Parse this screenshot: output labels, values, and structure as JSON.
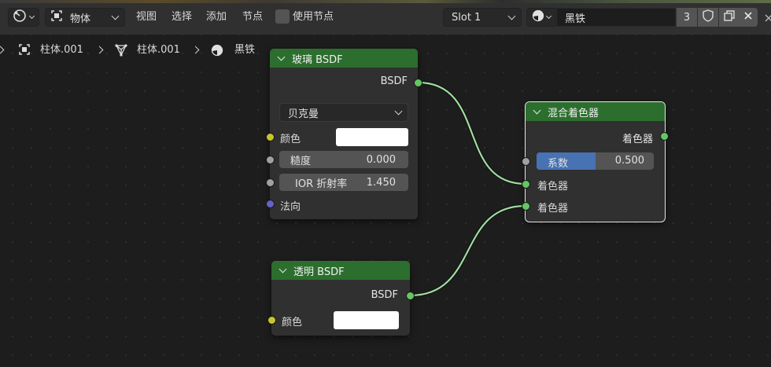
{
  "header": {
    "mode_select_icon": "editor-type-icon",
    "object_mode_label": "物体",
    "menus": [
      "视图",
      "选择",
      "添加",
      "节点"
    ],
    "use_nodes_label": "使用节点",
    "slot_label": "Slot 1",
    "material_name": "黑铁",
    "user_count": "3"
  },
  "breadcrumb": {
    "object_name": "柱体.001",
    "mesh_name": "柱体.001",
    "material_name": "黑铁"
  },
  "nodes": {
    "glass": {
      "title": "玻璃 BSDF",
      "output_label": "BSDF",
      "distribution": "贝克曼",
      "color_label": "颜色",
      "color_value": "#ffffff",
      "roughness_label": "糙度",
      "roughness_value": "0.000",
      "ior_label": "IOR 折射率",
      "ior_value": "1.450",
      "normal_label": "法向"
    },
    "mix": {
      "title": "混合着色器",
      "output_label": "着色器",
      "factor_label": "系数",
      "factor_value": "0.500",
      "factor_fraction": 0.5,
      "input1_label": "着色器",
      "input2_label": "着色器"
    },
    "transparent": {
      "title": "透明 BSDF",
      "output_label": "BSDF",
      "color_label": "颜色",
      "color_value": "#ffffff"
    }
  },
  "colors": {
    "node_header": "#2c6e2e",
    "shader_socket": "#63c763",
    "color_socket": "#c7c729",
    "float_socket": "#a1a1a1",
    "vector_socket": "#6363c7",
    "link": "#a0dca0",
    "factor_fill": "#4772b3"
  }
}
